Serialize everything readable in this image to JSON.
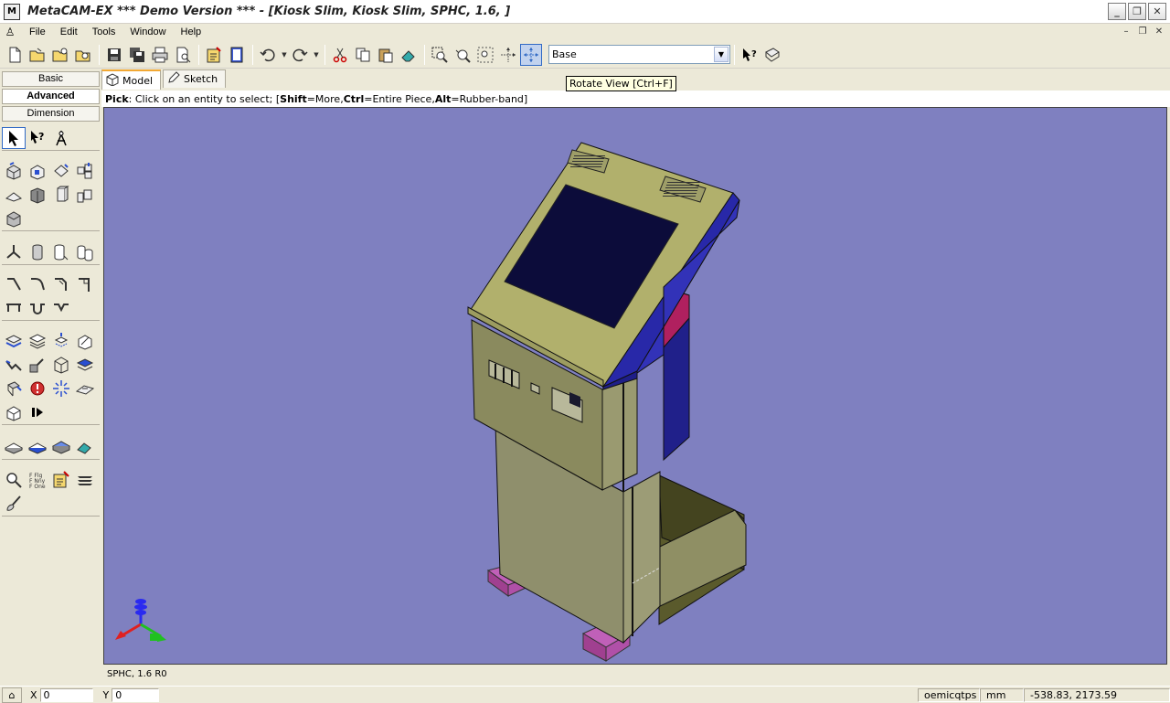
{
  "window": {
    "title": "MetaCAM-EX *** Demo Version ***  - [Kiosk Slim, Kiosk Slim, SPHC, 1.6, ]",
    "app_icon": "M"
  },
  "menu": {
    "items": [
      "File",
      "Edit",
      "Tools",
      "Window",
      "Help"
    ]
  },
  "toolbar": {
    "view_select": "Base",
    "tooltip": "Rotate View [Ctrl+F]"
  },
  "left_panel": {
    "modes": [
      "Basic",
      "Advanced",
      "Dimension"
    ],
    "selected_mode": "Advanced"
  },
  "tabs": [
    {
      "label": "Model",
      "icon": "cube-icon",
      "active": true
    },
    {
      "label": "Sketch",
      "icon": "pencil-icon",
      "active": false
    }
  ],
  "hint": {
    "pick": "Pick",
    "text1": ": Click on an entity to select; [",
    "shift": "Shift",
    "text2": "=More, ",
    "ctrl": "Ctrl",
    "text3": "=Entire Piece, ",
    "alt": "Alt",
    "text4": "=Rubber-band]"
  },
  "viewport": {
    "background": "#7f80c0"
  },
  "material_line": "SPHC, 1.6 R0",
  "status": {
    "x_label": "X",
    "x_value": "0",
    "y_label": "Y",
    "y_value": "0",
    "user": "oemicqtps",
    "units": "mm",
    "coords": "-538.83, 2173.59"
  },
  "colors": {
    "accent": "#316ac5",
    "viewport_bg": "#7f80c0",
    "panel_bg": "#ece9d8"
  }
}
